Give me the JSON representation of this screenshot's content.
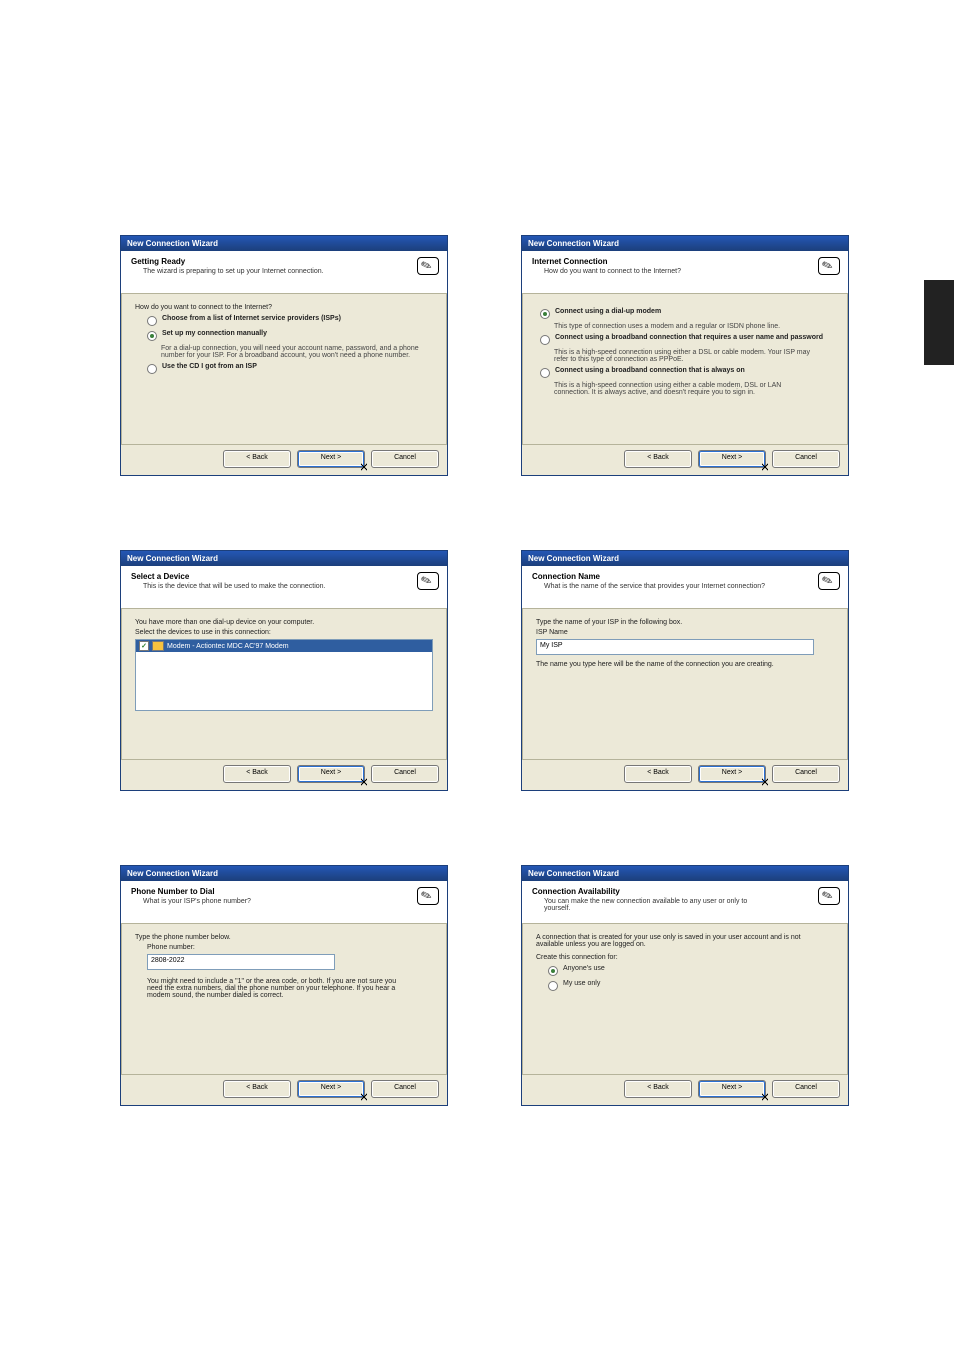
{
  "common": {
    "title": "New Connection Wizard",
    "back_label": "< Back",
    "next_label": "Next >",
    "cancel_label": "Cancel"
  },
  "d1": {
    "head_title": "Getting Ready",
    "head_sub": "The wizard is preparing to set up your Internet connection.",
    "q": "How do you want to connect to the Internet?",
    "opt1_label": "Choose from a list of Internet service providers (ISPs)",
    "opt2_label": "Set up my connection manually",
    "opt2_desc": "For a dial-up connection, you will need your account name, password, and a phone number for your ISP. For a broadband account, you won't need a phone number.",
    "opt3_label": "Use the CD I got from an ISP"
  },
  "d2": {
    "head_title": "Internet Connection",
    "head_sub": "How do you want to connect to the Internet?",
    "opt1_label": "Connect using a dial-up modem",
    "opt1_desc": "This type of connection uses a modem and a regular or ISDN phone line.",
    "opt2_label": "Connect using a broadband connection that requires a user name and password",
    "opt2_desc": "This is a high-speed connection using either a DSL or cable modem. Your ISP may refer to this type of connection as PPPoE.",
    "opt3_label": "Connect using a broadband connection that is always on",
    "opt3_desc": "This is a high-speed connection using either a cable modem, DSL or LAN connection. It is always active, and doesn't require you to sign in."
  },
  "d3": {
    "head_title": "Select a Device",
    "head_sub": "This is the device that will be used to make the connection.",
    "line1": "You have more than one dial-up device on your computer.",
    "line2": "Select the devices to use in this connection:",
    "device": "Modem - Actiontec MDC AC'97 Modem"
  },
  "d4": {
    "head_title": "Connection Name",
    "head_sub": "What is the name of the service that provides your Internet connection?",
    "line1": "Type the name of your ISP in the following box.",
    "label": "ISP Name",
    "value": "My ISP",
    "hint": "The name you type here will be the name of the connection you are creating."
  },
  "d5": {
    "head_title": "Phone Number to Dial",
    "head_sub": "What is your ISP's phone number?",
    "line1": "Type the phone number below.",
    "label": "Phone number:",
    "value": "2808-2022",
    "hint": "You might need to include a \"1\" or the area code, or both. If you are not sure you need the extra numbers, dial the phone number on your telephone. If you hear a modem sound, the number dialed is correct."
  },
  "d6": {
    "head_title": "Connection Availability",
    "head_sub": "You can make the new connection available to any user or only to yourself.",
    "line1": "A connection that is created for your use only is saved in your user account and is not available unless you are logged on.",
    "label": "Create this connection for:",
    "opt1_label": "Anyone's use",
    "opt2_label": "My use only"
  }
}
